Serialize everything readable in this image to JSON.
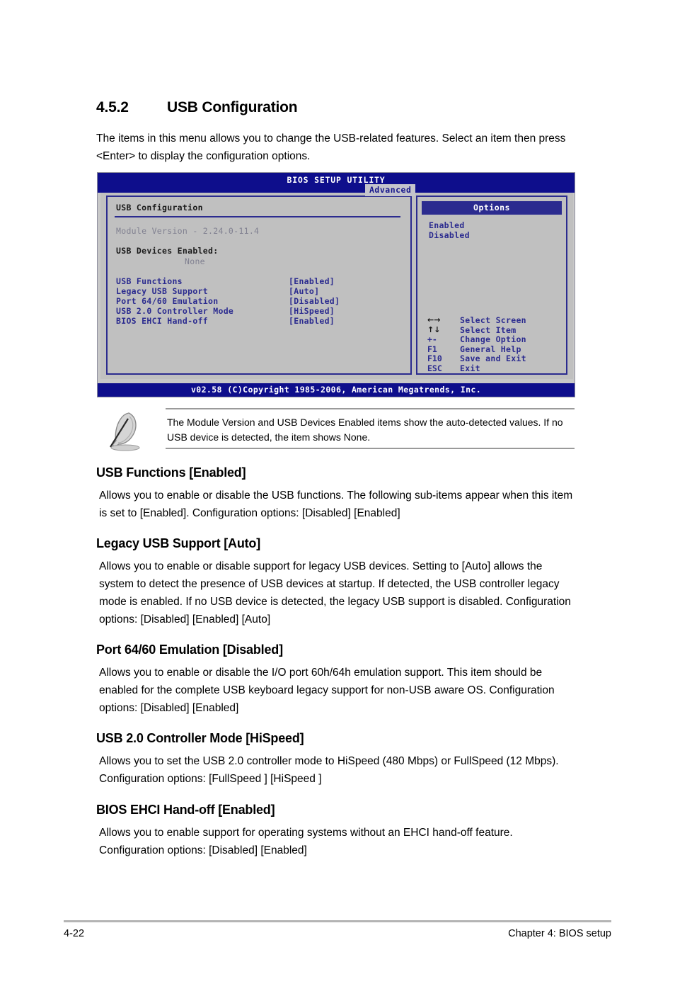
{
  "section": {
    "number": "4.5.2",
    "title": "USB Configuration",
    "intro": "The items in this menu allows you to change the USB-related features. Select an item then press <Enter> to display the configuration options."
  },
  "bios": {
    "title": "BIOS SETUP UTILITY",
    "tab": "Advanced",
    "panel_title": "USB Configuration",
    "module_version": "Module Version - 2.24.0-11.4",
    "devices_enabled_label": "USB Devices Enabled:",
    "devices_enabled_value": "None",
    "menu_items": [
      {
        "label": "USB Functions",
        "value": "[Enabled]"
      },
      {
        "label": "Legacy USB Support",
        "value": "[Auto]"
      },
      {
        "label": "Port 64/60 Emulation",
        "value": "[Disabled]"
      },
      {
        "label": "USB 2.0 Controller Mode",
        "value": "[HiSpeed]"
      },
      {
        "label": "BIOS EHCI Hand-off",
        "value": "[Enabled]"
      }
    ],
    "options_header": "Options",
    "options": [
      "Enabled",
      "Disabled"
    ],
    "keys": [
      {
        "glyph": "←→",
        "glyph_kind": "arrow",
        "desc": "Select Screen"
      },
      {
        "glyph": "↑↓",
        "glyph_kind": "arrow",
        "desc": "Select Item"
      },
      {
        "glyph": "+-",
        "glyph_kind": "text",
        "desc": "Change Option"
      },
      {
        "glyph": "F1",
        "glyph_kind": "text",
        "desc": "General Help"
      },
      {
        "glyph": "F10",
        "glyph_kind": "text",
        "desc": "Save and Exit"
      },
      {
        "glyph": "ESC",
        "glyph_kind": "text",
        "desc": "Exit"
      }
    ],
    "footer": "v02.58 (C)Copyright 1985-2006, American Megatrends, Inc.",
    "colors": {
      "title_bar": "#0e0e8c",
      "panel_bg": "#c0c0c0",
      "border": "#2b2b8f",
      "menu_text": "#2b2b8f",
      "dim_text": "#808090"
    }
  },
  "note": {
    "icon": "quill-pen-icon",
    "text": "The Module Version and USB Devices Enabled items show the auto-detected values. If no USB device is detected, the item shows None."
  },
  "items": [
    {
      "title": "USB Functions [Enabled]",
      "body": "Allows you to enable or disable the USB functions. The following sub-items appear when this item is set to [Enabled]. Configuration options: [Disabled] [Enabled]"
    },
    {
      "title": "Legacy USB Support [Auto]",
      "body": "Allows you to enable or disable support for legacy USB devices. Setting to [Auto] allows the system to detect the presence of USB devices at startup. If detected, the USB controller legacy mode is enabled. If no USB device is detected, the legacy USB support is disabled. Configuration options: [Disabled] [Enabled] [Auto]"
    },
    {
      "title": "Port 64/60 Emulation [Disabled]",
      "body": "Allows you to enable or disable the I/O port 60h/64h emulation support. This item should be enabled for the complete USB keyboard legacy support for non-USB aware OS. Configuration options: [Disabled] [Enabled]"
    },
    {
      "title": "USB 2.0 Controller Mode [HiSpeed]",
      "body": "Allows you to set the USB 2.0 controller mode to HiSpeed (480 Mbps) or FullSpeed (12 Mbps). Configuration options: [FullSpeed ] [HiSpeed ]"
    },
    {
      "title": "BIOS EHCI Hand-off [Enabled]",
      "body": "Allows you to enable support for operating systems without an EHCI hand-off feature. Configuration options: [Disabled] [Enabled]"
    }
  ],
  "footer": {
    "page_number": "4-22",
    "chapter": "Chapter 4: BIOS setup"
  }
}
